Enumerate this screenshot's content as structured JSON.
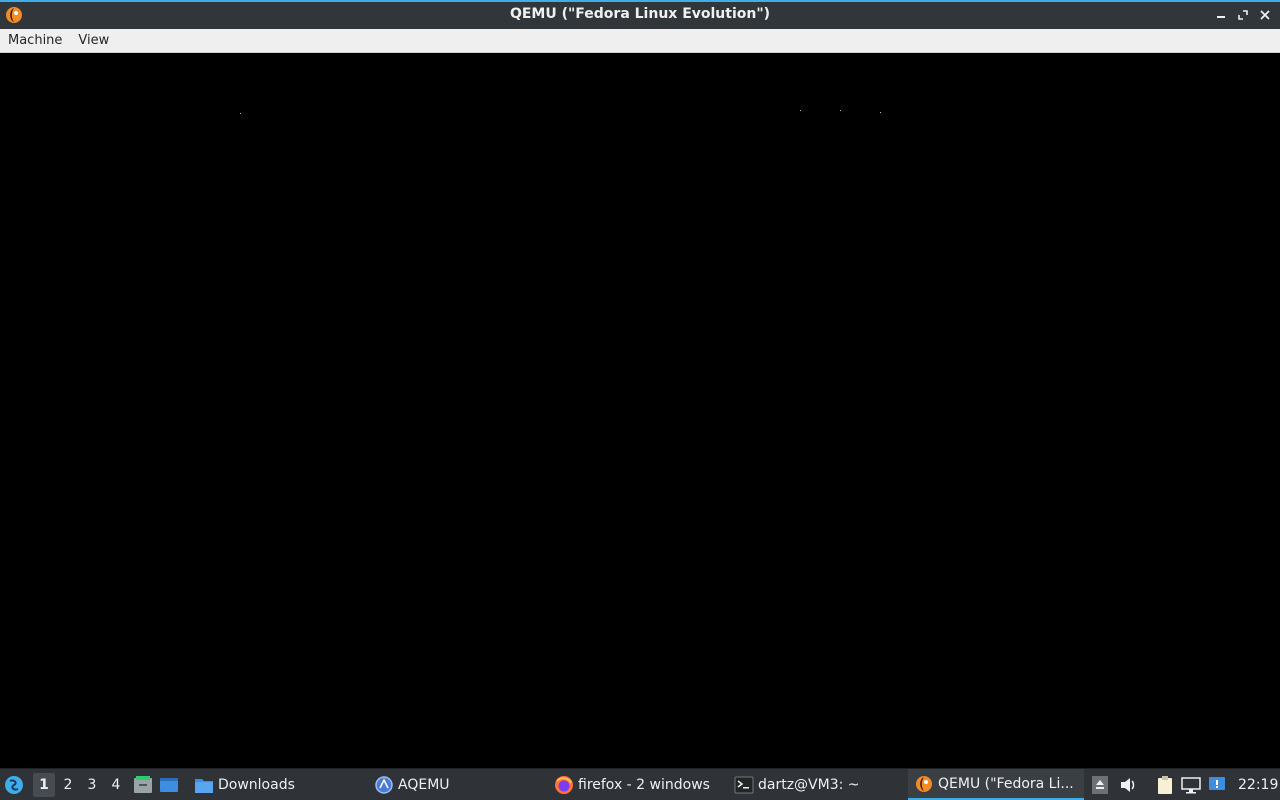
{
  "window": {
    "title": "QEMU (\"Fedora Linux Evolution\")",
    "icon": "qemu-icon",
    "controls": [
      "minimize-icon",
      "maximize-icon",
      "close-icon"
    ]
  },
  "menubar": {
    "items": [
      {
        "label": "Machine"
      },
      {
        "label": "View"
      }
    ]
  },
  "screen": {
    "background": "#000000"
  },
  "taskbar": {
    "start_icon": "start-menu-icon",
    "desktops": [
      "1",
      "2",
      "3",
      "4"
    ],
    "active_desktop": "1",
    "quicklaunch": [
      "file-manager-icon",
      "show-desktop-icon"
    ],
    "tasks": [
      {
        "label": "Downloads",
        "icon": "folder-icon",
        "active": false
      },
      {
        "label": "AQEMU",
        "icon": "aqemu-icon",
        "active": false
      },
      {
        "label": "firefox - 2 windows",
        "icon": "firefox-icon",
        "active": false
      },
      {
        "label": "dartz@VM3: ~",
        "icon": "terminal-icon",
        "active": false
      },
      {
        "label": "QEMU (\"Fedora Li...",
        "icon": "qemu-icon",
        "active": true
      }
    ],
    "tray": [
      "eject-icon",
      "volume-icon",
      "clipboard-icon",
      "network-icon",
      "update-icon"
    ],
    "clock": "22:19"
  },
  "colors": {
    "accent": "#3daee9",
    "titlebar": "#31363b",
    "taskbar": "#2f3236",
    "menubar": "#efefef"
  }
}
